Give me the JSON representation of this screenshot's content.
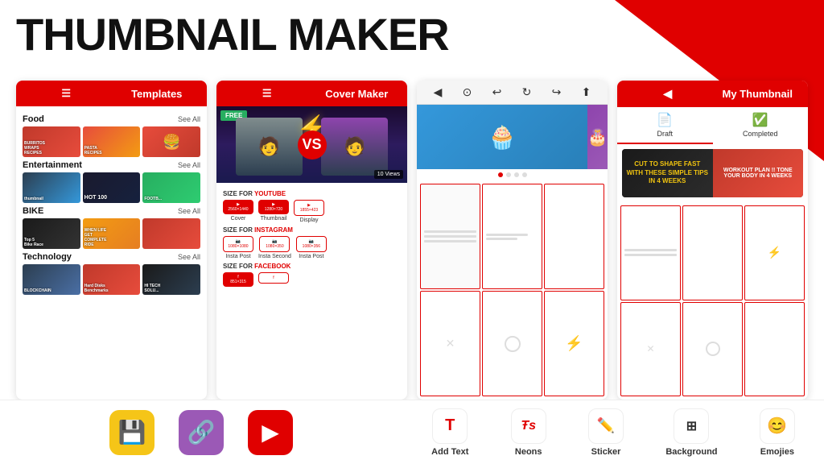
{
  "app": {
    "title": "THUMBNAIL MAKER"
  },
  "screen1": {
    "header": "Templates",
    "categories": [
      {
        "name": "Food",
        "see_all": "See All",
        "thumbs": [
          "BURRITOS WRAPS RECIPES",
          "PASTA RECIPES",
          "🍔"
        ]
      },
      {
        "name": "Entertainment",
        "see_all": "See All",
        "thumbs": [
          "thumbnail",
          "HOT 100",
          "FOOTB..."
        ]
      },
      {
        "name": "BIKE",
        "see_all": "See All",
        "thumbs": [
          "Top Bike Race",
          "WHEN LIFE GET COMPLETE RIDE",
          ""
        ]
      },
      {
        "name": "Technology",
        "see_all": "See All",
        "thumbs": [
          "BLOCKCHAIN",
          "Hard Disks Benchmarks",
          "HI TECH SOLU..."
        ]
      }
    ]
  },
  "screen2": {
    "header": "Cover Maker",
    "vs_label": "VS",
    "free_label": "FREE",
    "views_label": "10 Views",
    "sections": [
      {
        "label": "SIZE FOR YOUTUBE",
        "color": "red",
        "items": [
          {
            "size": "2560×1440",
            "label": "Cover"
          },
          {
            "size": "1280×720",
            "label": "Thumbnail"
          },
          {
            "size": "1855×423",
            "label": "Display"
          }
        ]
      },
      {
        "label": "SIZE FOR INSTAGRAM",
        "color": "red",
        "items": [
          {
            "size": "1080×1080",
            "label": "Insta Post"
          },
          {
            "size": "1080×350",
            "label": "Insta Second"
          },
          {
            "size": "1080×356",
            "label": "Insta Post"
          }
        ]
      },
      {
        "label": "SIZE FOR FACEBOOK",
        "color": "red",
        "items": []
      }
    ]
  },
  "screen3": {
    "nav_icons": [
      "◀",
      "⊙",
      "↩",
      "↻",
      "↪",
      "⬆"
    ],
    "dots": [
      true,
      false,
      false,
      false
    ]
  },
  "screen4": {
    "header": "My Thumbnail",
    "tabs": [
      {
        "icon": "📄",
        "label": "Draft",
        "active": true
      },
      {
        "icon": "✅",
        "label": "Completed",
        "active": false
      }
    ],
    "preview_left": "CUT TO SHAPE FAST WITH THESE SIMPLE TIPS IN 4 WEEKS",
    "preview_right": "WORKOUT PLAN !! TONE YOUR BODY IN 4 WEEKS"
  },
  "bottom_left": {
    "icons": [
      "💾",
      "🔗",
      "▶"
    ]
  },
  "bottom_right": {
    "tools": [
      {
        "icon": "T",
        "label": "Add Text"
      },
      {
        "icon": "TS",
        "label": "Neons"
      },
      {
        "icon": "✏",
        "label": "Sticker"
      },
      {
        "icon": "⊞",
        "label": "Background"
      },
      {
        "icon": "😊",
        "label": "Emojies"
      }
    ]
  }
}
